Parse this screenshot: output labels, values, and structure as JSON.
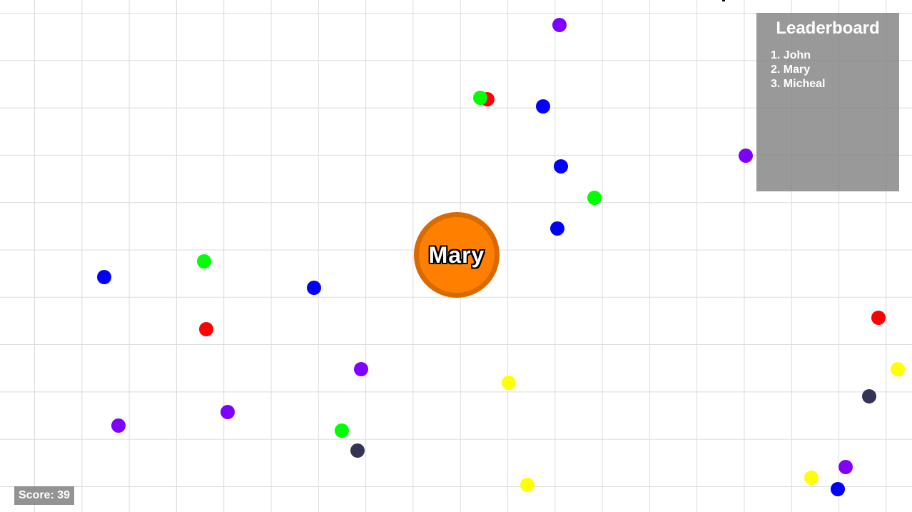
{
  "player": {
    "name": "Mary",
    "color": "#ff8000",
    "border_color": "#d96a00"
  },
  "leaderboard": {
    "title": "Leaderboard",
    "entries": [
      "1. John",
      "2. Mary",
      "3. Micheal"
    ]
  },
  "score": {
    "label": "Score: 39",
    "value": 39
  },
  "colors": {
    "background": "#ffffff",
    "grid": "#dcdcdc",
    "panel": "#808080",
    "food": [
      "#8000ff",
      "#0000ff",
      "#00ff00",
      "#ff0000",
      "#ffff00",
      "#333355"
    ]
  }
}
